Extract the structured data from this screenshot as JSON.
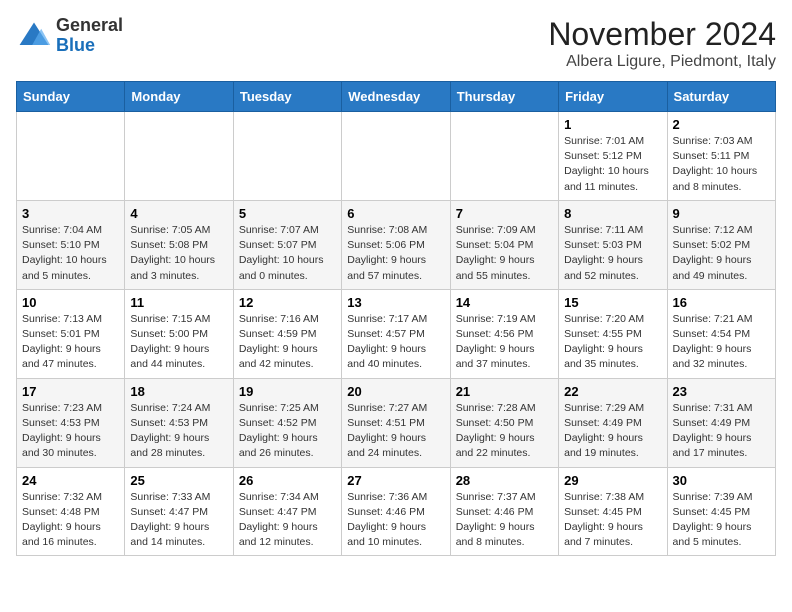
{
  "header": {
    "logo_general": "General",
    "logo_blue": "Blue",
    "month_title": "November 2024",
    "location": "Albera Ligure, Piedmont, Italy"
  },
  "weekdays": [
    "Sunday",
    "Monday",
    "Tuesday",
    "Wednesday",
    "Thursday",
    "Friday",
    "Saturday"
  ],
  "weeks": [
    [
      {
        "day": "",
        "detail": ""
      },
      {
        "day": "",
        "detail": ""
      },
      {
        "day": "",
        "detail": ""
      },
      {
        "day": "",
        "detail": ""
      },
      {
        "day": "",
        "detail": ""
      },
      {
        "day": "1",
        "detail": "Sunrise: 7:01 AM\nSunset: 5:12 PM\nDaylight: 10 hours\nand 11 minutes."
      },
      {
        "day": "2",
        "detail": "Sunrise: 7:03 AM\nSunset: 5:11 PM\nDaylight: 10 hours\nand 8 minutes."
      }
    ],
    [
      {
        "day": "3",
        "detail": "Sunrise: 7:04 AM\nSunset: 5:10 PM\nDaylight: 10 hours\nand 5 minutes."
      },
      {
        "day": "4",
        "detail": "Sunrise: 7:05 AM\nSunset: 5:08 PM\nDaylight: 10 hours\nand 3 minutes."
      },
      {
        "day": "5",
        "detail": "Sunrise: 7:07 AM\nSunset: 5:07 PM\nDaylight: 10 hours\nand 0 minutes."
      },
      {
        "day": "6",
        "detail": "Sunrise: 7:08 AM\nSunset: 5:06 PM\nDaylight: 9 hours\nand 57 minutes."
      },
      {
        "day": "7",
        "detail": "Sunrise: 7:09 AM\nSunset: 5:04 PM\nDaylight: 9 hours\nand 55 minutes."
      },
      {
        "day": "8",
        "detail": "Sunrise: 7:11 AM\nSunset: 5:03 PM\nDaylight: 9 hours\nand 52 minutes."
      },
      {
        "day": "9",
        "detail": "Sunrise: 7:12 AM\nSunset: 5:02 PM\nDaylight: 9 hours\nand 49 minutes."
      }
    ],
    [
      {
        "day": "10",
        "detail": "Sunrise: 7:13 AM\nSunset: 5:01 PM\nDaylight: 9 hours\nand 47 minutes."
      },
      {
        "day": "11",
        "detail": "Sunrise: 7:15 AM\nSunset: 5:00 PM\nDaylight: 9 hours\nand 44 minutes."
      },
      {
        "day": "12",
        "detail": "Sunrise: 7:16 AM\nSunset: 4:59 PM\nDaylight: 9 hours\nand 42 minutes."
      },
      {
        "day": "13",
        "detail": "Sunrise: 7:17 AM\nSunset: 4:57 PM\nDaylight: 9 hours\nand 40 minutes."
      },
      {
        "day": "14",
        "detail": "Sunrise: 7:19 AM\nSunset: 4:56 PM\nDaylight: 9 hours\nand 37 minutes."
      },
      {
        "day": "15",
        "detail": "Sunrise: 7:20 AM\nSunset: 4:55 PM\nDaylight: 9 hours\nand 35 minutes."
      },
      {
        "day": "16",
        "detail": "Sunrise: 7:21 AM\nSunset: 4:54 PM\nDaylight: 9 hours\nand 32 minutes."
      }
    ],
    [
      {
        "day": "17",
        "detail": "Sunrise: 7:23 AM\nSunset: 4:53 PM\nDaylight: 9 hours\nand 30 minutes."
      },
      {
        "day": "18",
        "detail": "Sunrise: 7:24 AM\nSunset: 4:53 PM\nDaylight: 9 hours\nand 28 minutes."
      },
      {
        "day": "19",
        "detail": "Sunrise: 7:25 AM\nSunset: 4:52 PM\nDaylight: 9 hours\nand 26 minutes."
      },
      {
        "day": "20",
        "detail": "Sunrise: 7:27 AM\nSunset: 4:51 PM\nDaylight: 9 hours\nand 24 minutes."
      },
      {
        "day": "21",
        "detail": "Sunrise: 7:28 AM\nSunset: 4:50 PM\nDaylight: 9 hours\nand 22 minutes."
      },
      {
        "day": "22",
        "detail": "Sunrise: 7:29 AM\nSunset: 4:49 PM\nDaylight: 9 hours\nand 19 minutes."
      },
      {
        "day": "23",
        "detail": "Sunrise: 7:31 AM\nSunset: 4:49 PM\nDaylight: 9 hours\nand 17 minutes."
      }
    ],
    [
      {
        "day": "24",
        "detail": "Sunrise: 7:32 AM\nSunset: 4:48 PM\nDaylight: 9 hours\nand 16 minutes."
      },
      {
        "day": "25",
        "detail": "Sunrise: 7:33 AM\nSunset: 4:47 PM\nDaylight: 9 hours\nand 14 minutes."
      },
      {
        "day": "26",
        "detail": "Sunrise: 7:34 AM\nSunset: 4:47 PM\nDaylight: 9 hours\nand 12 minutes."
      },
      {
        "day": "27",
        "detail": "Sunrise: 7:36 AM\nSunset: 4:46 PM\nDaylight: 9 hours\nand 10 minutes."
      },
      {
        "day": "28",
        "detail": "Sunrise: 7:37 AM\nSunset: 4:46 PM\nDaylight: 9 hours\nand 8 minutes."
      },
      {
        "day": "29",
        "detail": "Sunrise: 7:38 AM\nSunset: 4:45 PM\nDaylight: 9 hours\nand 7 minutes."
      },
      {
        "day": "30",
        "detail": "Sunrise: 7:39 AM\nSunset: 4:45 PM\nDaylight: 9 hours\nand 5 minutes."
      }
    ]
  ]
}
